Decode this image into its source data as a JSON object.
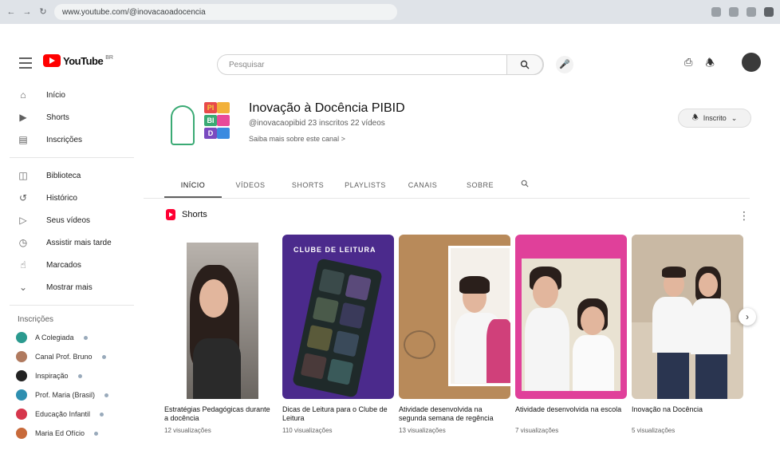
{
  "browser": {
    "url": "www.youtube.com/@inovacaoadocencia"
  },
  "header": {
    "logo_text": "YouTube",
    "logo_suffix": "BR",
    "search_placeholder": "Pesquisar"
  },
  "sidebar": {
    "items": [
      {
        "label": "Início",
        "icon": "home-icon"
      },
      {
        "label": "Shorts",
        "icon": "shorts-icon"
      },
      {
        "label": "Inscrições",
        "icon": "subscriptions-icon"
      }
    ],
    "items2": [
      {
        "label": "Biblioteca",
        "icon": "library-icon"
      },
      {
        "label": "Histórico",
        "icon": "history-icon"
      },
      {
        "label": "Seus vídeos",
        "icon": "your-videos-icon"
      },
      {
        "label": "Assistir mais tarde",
        "icon": "watch-later-icon"
      },
      {
        "label": "Marcados",
        "icon": "thumbs-up-icon"
      },
      {
        "label": "Mostrar mais",
        "icon": "chevron-down-icon"
      }
    ],
    "subs_heading": "Inscrições",
    "subscriptions": [
      {
        "name": "A Colegiada",
        "color": "#2b9a8f"
      },
      {
        "name": "Canal Prof. Bruno",
        "color": "#b07a5f"
      },
      {
        "name": "Inspiração",
        "color": "#222222"
      },
      {
        "name": "Prof. Maria (Brasil)",
        "color": "#2e8fb0"
      },
      {
        "name": "Educação Infantil",
        "color": "#d6364c"
      },
      {
        "name": "Maria Ed Ofício",
        "color": "#c86a3a"
      }
    ]
  },
  "channel": {
    "name": "Inovação à Docência PIBID",
    "meta": "@inovacaopibid  23 inscritos  22 vídeos",
    "description": "Saiba mais sobre este canal  >",
    "subscribe_label": "Inscrito",
    "logo_letters": [
      "PI",
      "BI",
      "D"
    ]
  },
  "tabs": [
    "INÍCIO",
    "VÍDEOS",
    "SHORTS",
    "PLAYLISTS",
    "CANAIS",
    "SOBRE"
  ],
  "shorts": {
    "title": "Shorts",
    "items": [
      {
        "title": "Estratégias Pedagógicas durante a docência",
        "views": "12 visualizações"
      },
      {
        "title": "Dicas de Leitura para o Clube de Leitura",
        "views": "110 visualizações"
      },
      {
        "title": "Atividade desenvolvida na segunda semana de regência",
        "views": "13 visualizações"
      },
      {
        "title": "Atividade desenvolvida na escola",
        "views": "7 visualizações"
      },
      {
        "title": "Inovação na Docência",
        "views": "5 visualizações"
      }
    ],
    "clube_text": "CLUBE DE LEITURA"
  },
  "colors": {
    "brand_red": "#ff0000",
    "clube_purple": "#4b2a8c",
    "pink_frame": "#e0409a"
  }
}
